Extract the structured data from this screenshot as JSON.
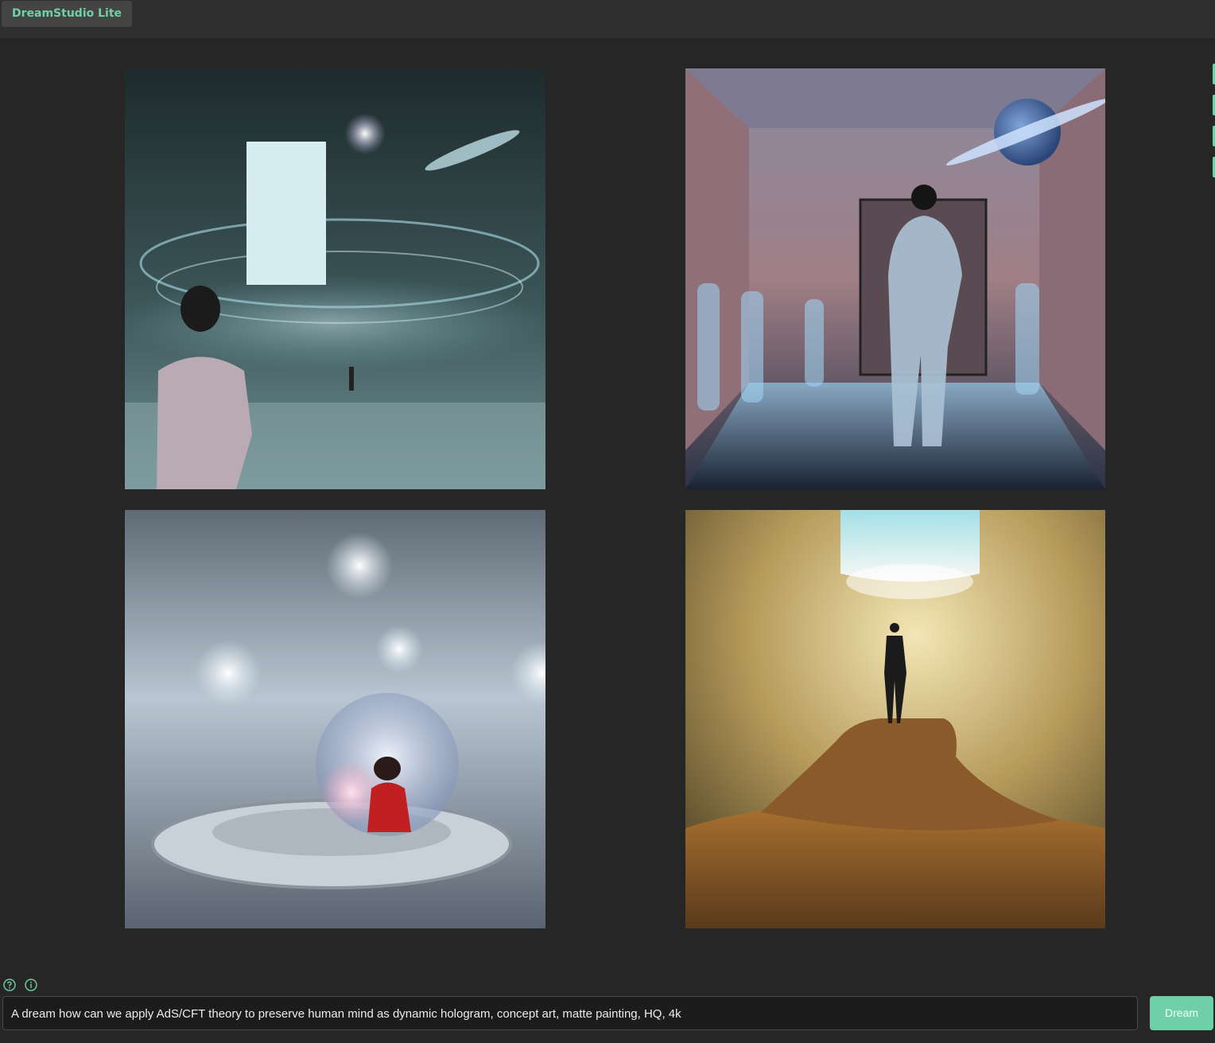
{
  "header": {
    "app_title": "DreamStudio Lite"
  },
  "gallery": {
    "images": [
      {
        "description": "person facing holographic rings with a glowing white monolith"
      },
      {
        "description": "translucent hologram figure standing in a pink hallway with a planet"
      },
      {
        "description": "figure in red inside a translucent sphere in a white futuristic room"
      },
      {
        "description": "silhouette on a rocky mound under a glowing blue light column"
      }
    ]
  },
  "icons": {
    "help": "help-circle-icon",
    "info": "info-circle-icon"
  },
  "prompt": {
    "value": "A dream how can we apply AdS/CFT theory to preserve human mind as dynamic hologram, concept art, matte painting, HQ, 4k"
  },
  "actions": {
    "dream_label": "Dream"
  },
  "colors": {
    "accent": "#6fd0a7",
    "background": "#262626",
    "topbar": "#2f2f2f"
  }
}
